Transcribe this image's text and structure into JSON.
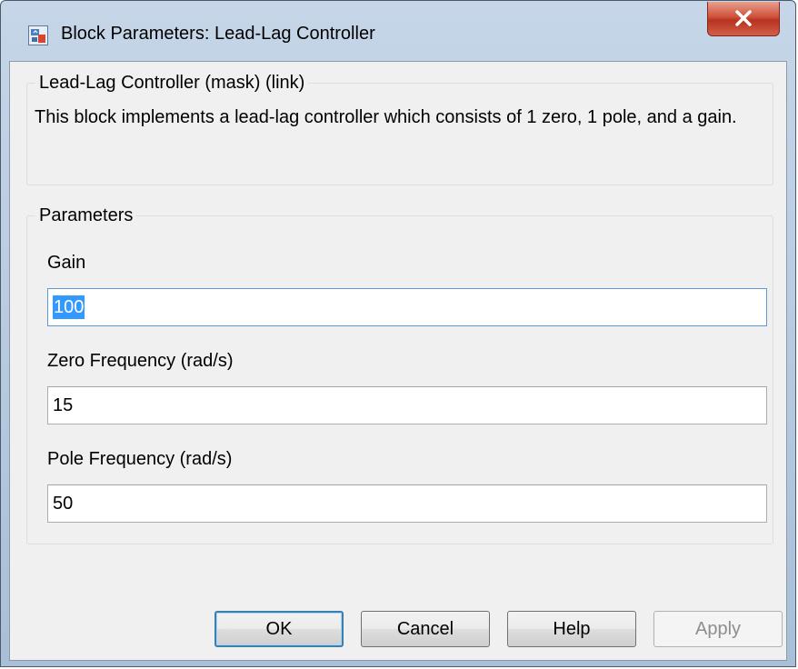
{
  "window": {
    "title": "Block Parameters: Lead-Lag Controller",
    "icon": "simulink-block-icon",
    "close_icon": "close-x-icon",
    "close_color": "#c7432e"
  },
  "description_group": {
    "legend": "Lead-Lag Controller (mask) (link)",
    "text": "This block implements a lead-lag controller which consists of 1 zero, 1 pole, and a gain."
  },
  "parameters_group": {
    "legend": "Parameters",
    "fields": [
      {
        "label": "Gain",
        "value": "100",
        "selected": true
      },
      {
        "label": "Zero Frequency (rad/s)",
        "value": "15",
        "selected": false
      },
      {
        "label": "Pole Frequency (rad/s)",
        "value": "50",
        "selected": false
      }
    ]
  },
  "buttons": {
    "ok": "OK",
    "cancel": "Cancel",
    "help": "Help",
    "apply": "Apply"
  },
  "colors": {
    "selection": "#3399ff",
    "default_button_border": "#3c7fb1"
  }
}
